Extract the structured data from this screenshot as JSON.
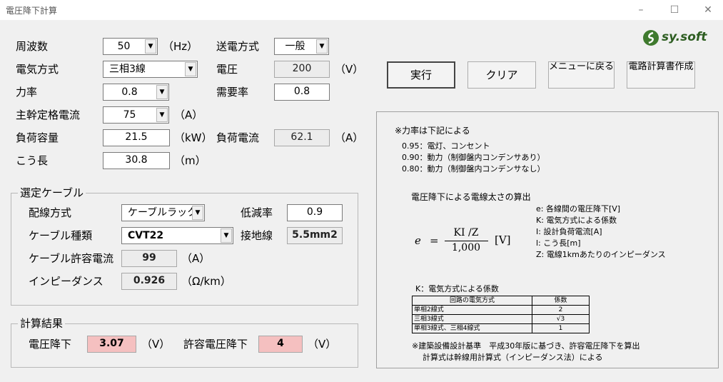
{
  "window": {
    "title": "電圧降下計算",
    "minimize": "–",
    "maximize": "☐",
    "close": "✕"
  },
  "logo": {
    "text": "sy.soft"
  },
  "form": {
    "frequency": {
      "label": "周波数",
      "value": "50",
      "unit": "（Hz）"
    },
    "transmission": {
      "label": "送電方式",
      "value": "一般"
    },
    "electric_method": {
      "label": "電気方式",
      "value": "三相3線"
    },
    "voltage": {
      "label": "電圧",
      "value": "200",
      "unit": "（V）"
    },
    "power_factor": {
      "label": "力率",
      "value": "0.8"
    },
    "demand_factor": {
      "label": "需要率",
      "value": "0.8"
    },
    "main_current": {
      "label": "主幹定格電流",
      "value": "75",
      "unit": "（A）"
    },
    "load_capacity": {
      "label": "負荷容量",
      "value": "21.5",
      "unit": "（kW）"
    },
    "load_current": {
      "label": "負荷電流",
      "value": "62.1",
      "unit": "（A）"
    },
    "length": {
      "label": "こう長",
      "value": "30.8",
      "unit": "（m）"
    }
  },
  "buttons": {
    "run": "実行",
    "clear": "クリア",
    "menu": "メニューに戻る",
    "report": "電路計算書作成"
  },
  "cable": {
    "group_title": "選定ケーブル",
    "wiring": {
      "label": "配線方式",
      "value": "ケーブルラック"
    },
    "reduction": {
      "label": "低減率",
      "value": "0.9"
    },
    "type": {
      "label": "ケーブル種類",
      "value": "CVT22"
    },
    "ground": {
      "label": "接地線",
      "value": "5.5mm2"
    },
    "allowable": {
      "label": "ケーブル許容電流",
      "value": "99",
      "unit": "（A）"
    },
    "impedance": {
      "label": "インピーダンス",
      "value": "0.926",
      "unit": "（Ω/km）"
    }
  },
  "result": {
    "group_title": "計算結果",
    "drop": {
      "label": "電圧降下",
      "value": "3.07",
      "unit": "（V）"
    },
    "allowed_drop": {
      "label": "許容電圧降下",
      "value": "4",
      "unit": "（V）"
    }
  },
  "info": {
    "pf_title": "※力率は下記による",
    "pf_lines": [
      "0.95：電灯、コンセント",
      "0.90：動力（制御盤内コンデンサあり）",
      "0.80：動力（制御盤内コンデンサなし）"
    ],
    "formula_title": "電圧降下による電線太さの算出",
    "formula": {
      "lhs": "e",
      "eq": "=",
      "num": "KI /Z",
      "den": "1,000",
      "unit": "[V]"
    },
    "legend": [
      "e:  各線間の電圧降下[V]",
      "K:  電気方式による係数",
      "I:  設計負荷電流[A]",
      "l:  こう長[m]",
      "Z:  電線1kmあたりのインピーダンス"
    ],
    "k_title": "K：電気方式による係数",
    "k_table": {
      "headers": [
        "回路の電気方式",
        "係数"
      ],
      "rows": [
        [
          "単相2線式",
          "2"
        ],
        [
          "三相3線式",
          "√3"
        ],
        [
          "単相3線式、三相4線式",
          "1"
        ]
      ]
    },
    "note1": "※建築設備設計基準　平成30年版に基づき、許容電圧降下を算出",
    "note2": "計算式は幹線用計算式（インピーダンス法）による"
  }
}
